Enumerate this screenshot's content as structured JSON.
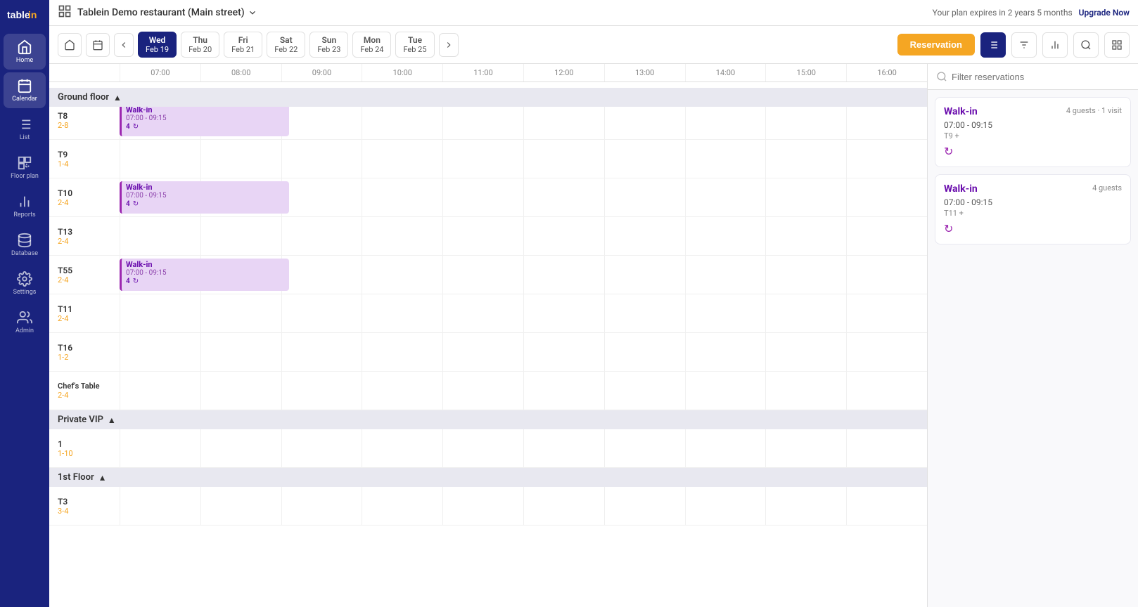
{
  "app": {
    "logo_text": "tablein",
    "plan_notice": "Your plan expires in 2 years 5 months",
    "upgrade_label": "Upgrade Now",
    "restaurant_name": "Tablein Demo restaurant (Main street)"
  },
  "sidebar": {
    "items": [
      {
        "id": "home",
        "label": "Home",
        "active": false
      },
      {
        "id": "calendar",
        "label": "Calendar",
        "active": true
      },
      {
        "id": "list",
        "label": "List",
        "active": false
      },
      {
        "id": "floor-plan",
        "label": "Floor plan",
        "active": false
      },
      {
        "id": "reports",
        "label": "Reports",
        "active": false
      },
      {
        "id": "database",
        "label": "Database",
        "active": false
      },
      {
        "id": "settings",
        "label": "Settings",
        "active": false
      },
      {
        "id": "admin",
        "label": "Admin",
        "active": false
      }
    ]
  },
  "toolbar": {
    "days": [
      {
        "name": "Wed",
        "date": "Feb 19",
        "active": true
      },
      {
        "name": "Thu",
        "date": "Feb 20",
        "active": false
      },
      {
        "name": "Fri",
        "date": "Feb 21",
        "active": false
      },
      {
        "name": "Sat",
        "date": "Feb 22",
        "active": false
      },
      {
        "name": "Sun",
        "date": "Feb 23",
        "active": false
      },
      {
        "name": "Mon",
        "date": "Feb 24",
        "active": false
      },
      {
        "name": "Tue",
        "date": "Feb 25",
        "active": false
      }
    ],
    "reservation_btn": "Reservation"
  },
  "time_slots": [
    "07:00",
    "08:00",
    "09:00",
    "10:00",
    "11:00",
    "12:00",
    "13:00",
    "14:00",
    "15:00",
    "16:00"
  ],
  "floors": [
    {
      "id": "ground-floor",
      "name": "Ground floor",
      "expanded": true,
      "tables": [
        {
          "id": "T8",
          "capacity": "2-8",
          "reservation": {
            "name": "Walk-in",
            "time": "07:00 - 09:15",
            "guests": 4,
            "start_pct": 0,
            "width_pct": 21
          }
        },
        {
          "id": "T9",
          "capacity": "1-4",
          "reservation": null
        },
        {
          "id": "T10",
          "capacity": "2-4",
          "reservation": {
            "name": "Walk-in",
            "time": "07:00 - 09:15",
            "guests": 4,
            "start_pct": 0,
            "width_pct": 21
          }
        },
        {
          "id": "T13",
          "capacity": "2-4",
          "reservation": null
        },
        {
          "id": "T55",
          "capacity": "2-4",
          "reservation": {
            "name": "Walk-in",
            "time": "07:00 - 09:15",
            "guests": 4,
            "start_pct": 0,
            "width_pct": 21
          }
        },
        {
          "id": "T11",
          "capacity": "2-4",
          "reservation": null
        },
        {
          "id": "T16",
          "capacity": "1-2",
          "reservation": null
        },
        {
          "id": "Chef's Table",
          "capacity": "2-4",
          "reservation": null
        }
      ]
    },
    {
      "id": "private-vip",
      "name": "Private VIP",
      "expanded": true,
      "tables": [
        {
          "id": "1",
          "capacity": "1-10",
          "reservation": null
        }
      ]
    },
    {
      "id": "1st-floor",
      "name": "1st Floor",
      "expanded": true,
      "tables": [
        {
          "id": "T3",
          "capacity": "3-4",
          "reservation": null
        }
      ]
    }
  ],
  "right_panel": {
    "filter_placeholder": "Filter reservations",
    "cards": [
      {
        "name": "Walk-in",
        "guests": "4 guests · 1 visit",
        "time": "07:00 - 09:15",
        "table": "T9 +"
      },
      {
        "name": "Walk-in",
        "guests": "4 guests",
        "time": "07:00 - 09:15",
        "table": "T11 +"
      }
    ]
  }
}
